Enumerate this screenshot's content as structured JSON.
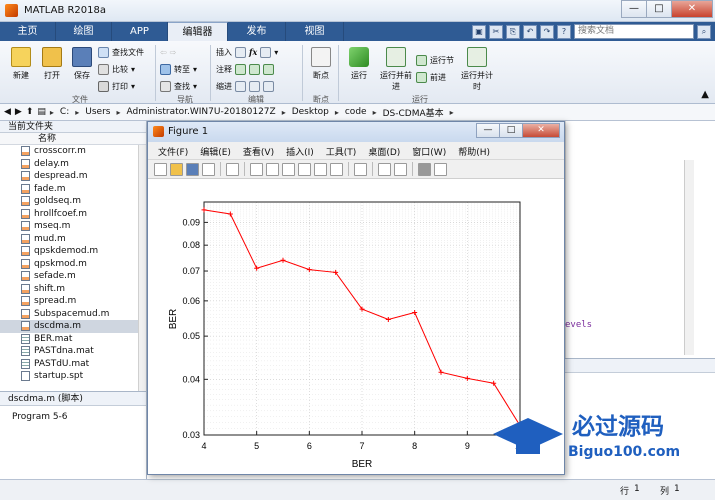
{
  "app": {
    "title": "MATLAB R2018a"
  },
  "window_buttons": {
    "minimize": "—",
    "maximize": "□",
    "close": "✕"
  },
  "tabs": [
    {
      "label": "主页"
    },
    {
      "label": "绘图"
    },
    {
      "label": "APP"
    },
    {
      "label": "编辑器"
    },
    {
      "label": "发布"
    },
    {
      "label": "视图"
    }
  ],
  "search": {
    "placeholder": "搜索文档"
  },
  "ribbon": {
    "file": {
      "new": "新建",
      "open": "打开",
      "save": "保存",
      "find_files": "查找文件",
      "compare": "比较",
      "print": "打印",
      "group": "文件"
    },
    "nav": {
      "goto": "转至",
      "find": "查找",
      "group": "导航"
    },
    "edit": {
      "insert": "插入",
      "comment": "注释",
      "indent": "缩进",
      "fx": "fx",
      "group": "编辑"
    },
    "breakpoint": {
      "label": "断点",
      "group": "断点"
    },
    "run": {
      "run": "运行",
      "run_advance": "运行并前进",
      "run_section": "运行节",
      "advance": "前进",
      "run_time": "运行并计时",
      "group": "运行"
    }
  },
  "address": {
    "segments": [
      "C:",
      "Users",
      "Administrator.WIN7U-20180127Z",
      "Desktop",
      "code",
      "DS-CDMA基本"
    ]
  },
  "file_panel": {
    "title": "当前文件夹",
    "column": "名称",
    "files": [
      {
        "name": "crosscorr.m",
        "type": "m"
      },
      {
        "name": "delay.m",
        "type": "m"
      },
      {
        "name": "despread.m",
        "type": "m"
      },
      {
        "name": "fade.m",
        "type": "m"
      },
      {
        "name": "goldseq.m",
        "type": "m"
      },
      {
        "name": "hrollfcoef.m",
        "type": "m"
      },
      {
        "name": "mseq.m",
        "type": "m"
      },
      {
        "name": "mud.m",
        "type": "m"
      },
      {
        "name": "qpskdemod.m",
        "type": "m"
      },
      {
        "name": "qpskmod.m",
        "type": "m"
      },
      {
        "name": "sefade.m",
        "type": "m"
      },
      {
        "name": "shift.m",
        "type": "m"
      },
      {
        "name": "spread.m",
        "type": "m"
      },
      {
        "name": "Subspacemud.m",
        "type": "m"
      },
      {
        "name": "dscdma.m",
        "type": "m",
        "selected": true
      },
      {
        "name": "BER.mat",
        "type": "mat"
      },
      {
        "name": "PASTdna.mat",
        "type": "mat"
      },
      {
        "name": "PASTdU.mat",
        "type": "mat"
      },
      {
        "name": "startup.spt",
        "type": "spt"
      }
    ]
  },
  "details": {
    "header": "dscdma.m  (脚本)",
    "body": "Program 5-6"
  },
  "editor": {
    "visible_text": "evels"
  },
  "status": {
    "row_label": "行",
    "row_value": "1",
    "col_label": "列",
    "col_value": "1"
  },
  "figure": {
    "title": "Figure 1",
    "menu": [
      "文件(F)",
      "编辑(E)",
      "查看(V)",
      "插入(I)",
      "工具(T)",
      "桌面(D)",
      "窗口(W)",
      "帮助(H)"
    ]
  },
  "chart_data": {
    "type": "line",
    "xlabel": "BER",
    "ylabel": "BER",
    "x": [
      4,
      4.5,
      5,
      5.5,
      6,
      6.5,
      7,
      7.5,
      8,
      8.5,
      9,
      9.5,
      10
    ],
    "series": [
      {
        "values": [
          0.096,
          0.094,
          0.071,
          0.074,
          0.0705,
          0.0695,
          0.0575,
          0.0545,
          0.0565,
          0.0415,
          0.0402,
          0.0392,
          0.0315
        ],
        "color": "#ff0000"
      }
    ],
    "xticks": [
      4,
      5,
      6,
      7,
      8,
      9,
      10
    ],
    "yticks": [
      0.03,
      0.04,
      0.05,
      0.06,
      0.07,
      0.08,
      0.09
    ],
    "xlim": [
      4,
      10
    ],
    "ylim": [
      0.03,
      0.1
    ],
    "yscale": "log",
    "grid": true
  },
  "watermark": {
    "text": "必过源码",
    "url": "Biguo100.com"
  }
}
